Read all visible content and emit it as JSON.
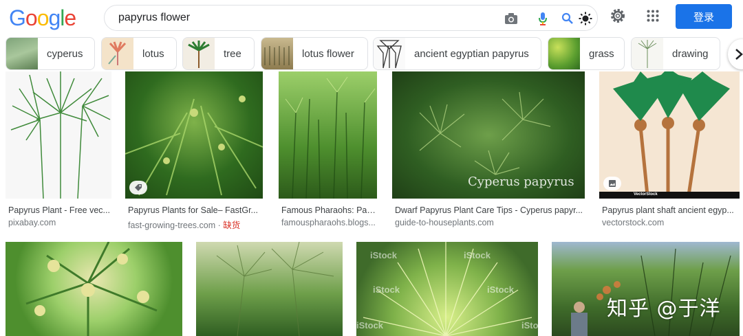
{
  "logo": {
    "text": "Google",
    "letters": [
      "G",
      "o",
      "o",
      "g",
      "l",
      "e"
    ],
    "colors": [
      "#4285f4",
      "#ea4335",
      "#fbbc05",
      "#4285f4",
      "#34a853",
      "#ea4335"
    ]
  },
  "search": {
    "query": "papyrus flower"
  },
  "header": {
    "login_label": "登录"
  },
  "chips": [
    {
      "label": "cyperus",
      "icon": "cyperus-thumbnail"
    },
    {
      "label": "lotus",
      "icon": "lotus-thumbnail"
    },
    {
      "label": "tree",
      "icon": "tree-thumbnail"
    },
    {
      "label": "lotus flower",
      "icon": "lotus-flower-thumbnail"
    },
    {
      "label": "ancient egyptian papyrus",
      "icon": "egyptian-papyrus-thumbnail"
    },
    {
      "label": "grass",
      "icon": "grass-thumbnail"
    },
    {
      "label": "drawing",
      "icon": "drawing-thumbnail"
    }
  ],
  "results_row1": [
    {
      "title": "Papyrus Plant - Free vec...",
      "source": "pixabay.com",
      "source_suffix": ""
    },
    {
      "title": "Papyrus Plants for Sale– FastGr...",
      "source": "fast-growing-trees.com · ",
      "source_suffix": "缺货"
    },
    {
      "title": "Famous Pharaohs: Pap...",
      "source": "famouspharaohs.blogs...",
      "source_suffix": ""
    },
    {
      "title": "Dwarf Papyrus Plant Care Tips - Cyperus papyr...",
      "source": "guide-to-houseplants.com",
      "source_suffix": ""
    },
    {
      "title": "Papyrus plant shaft ancient egyp...",
      "source": "vectorstock.com",
      "source_suffix": ""
    }
  ],
  "image_text": {
    "cyperus_papyrus": "Cyperus papyrus",
    "vectorstock": "VectorStock",
    "istock": "iStock",
    "zh_watermark": "知乎 @于洋"
  },
  "colors": {
    "accent": "#1a73e8",
    "warn": "#d93025"
  }
}
